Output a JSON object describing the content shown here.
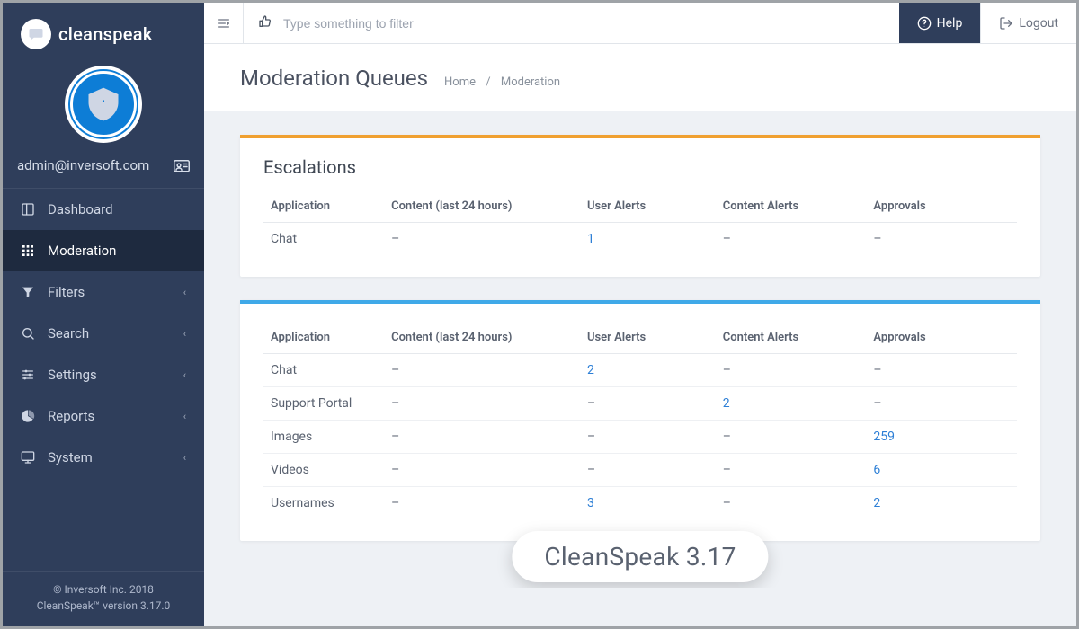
{
  "brand": {
    "name": "cleanspeak"
  },
  "user": {
    "email": "admin@inversoft.com"
  },
  "sidebar": {
    "items": [
      {
        "label": "Dashboard",
        "icon": "panel",
        "sub": false,
        "active": false
      },
      {
        "label": "Moderation",
        "icon": "grid",
        "sub": false,
        "active": true
      },
      {
        "label": "Filters",
        "icon": "funnel",
        "sub": true,
        "active": false
      },
      {
        "label": "Search",
        "icon": "search",
        "sub": true,
        "active": false
      },
      {
        "label": "Settings",
        "icon": "sliders",
        "sub": true,
        "active": false
      },
      {
        "label": "Reports",
        "icon": "pie",
        "sub": true,
        "active": false
      },
      {
        "label": "System",
        "icon": "monitor",
        "sub": true,
        "active": false
      }
    ]
  },
  "footer": {
    "line1": "© Inversoft Inc. 2018",
    "line2": "CleanSpeak™ version 3.17.0"
  },
  "topbar": {
    "filter_placeholder": "Type something to filter",
    "help": "Help",
    "logout": "Logout"
  },
  "page": {
    "title": "Moderation Queues",
    "crumb_home": "Home",
    "crumb_current": "Moderation"
  },
  "columns": [
    "Application",
    "Content (last 24 hours)",
    "User Alerts",
    "Content Alerts",
    "Approvals"
  ],
  "escalations": {
    "title": "Escalations",
    "rows": [
      {
        "app": "Chat",
        "content": "–",
        "user_alerts": "1",
        "content_alerts": "–",
        "approvals": "–"
      }
    ]
  },
  "queues": {
    "rows": [
      {
        "app": "Chat",
        "content": "–",
        "user_alerts": "2",
        "content_alerts": "–",
        "approvals": "–"
      },
      {
        "app": "Support Portal",
        "content": "–",
        "user_alerts": "–",
        "content_alerts": "2",
        "approvals": "–"
      },
      {
        "app": "Images",
        "content": "–",
        "user_alerts": "–",
        "content_alerts": "–",
        "approvals": "259"
      },
      {
        "app": "Videos",
        "content": "–",
        "user_alerts": "–",
        "content_alerts": "–",
        "approvals": "6"
      },
      {
        "app": "Usernames",
        "content": "–",
        "user_alerts": "3",
        "content_alerts": "–",
        "approvals": "2"
      }
    ]
  },
  "overlay_badge": "CleanSpeak 3.17"
}
